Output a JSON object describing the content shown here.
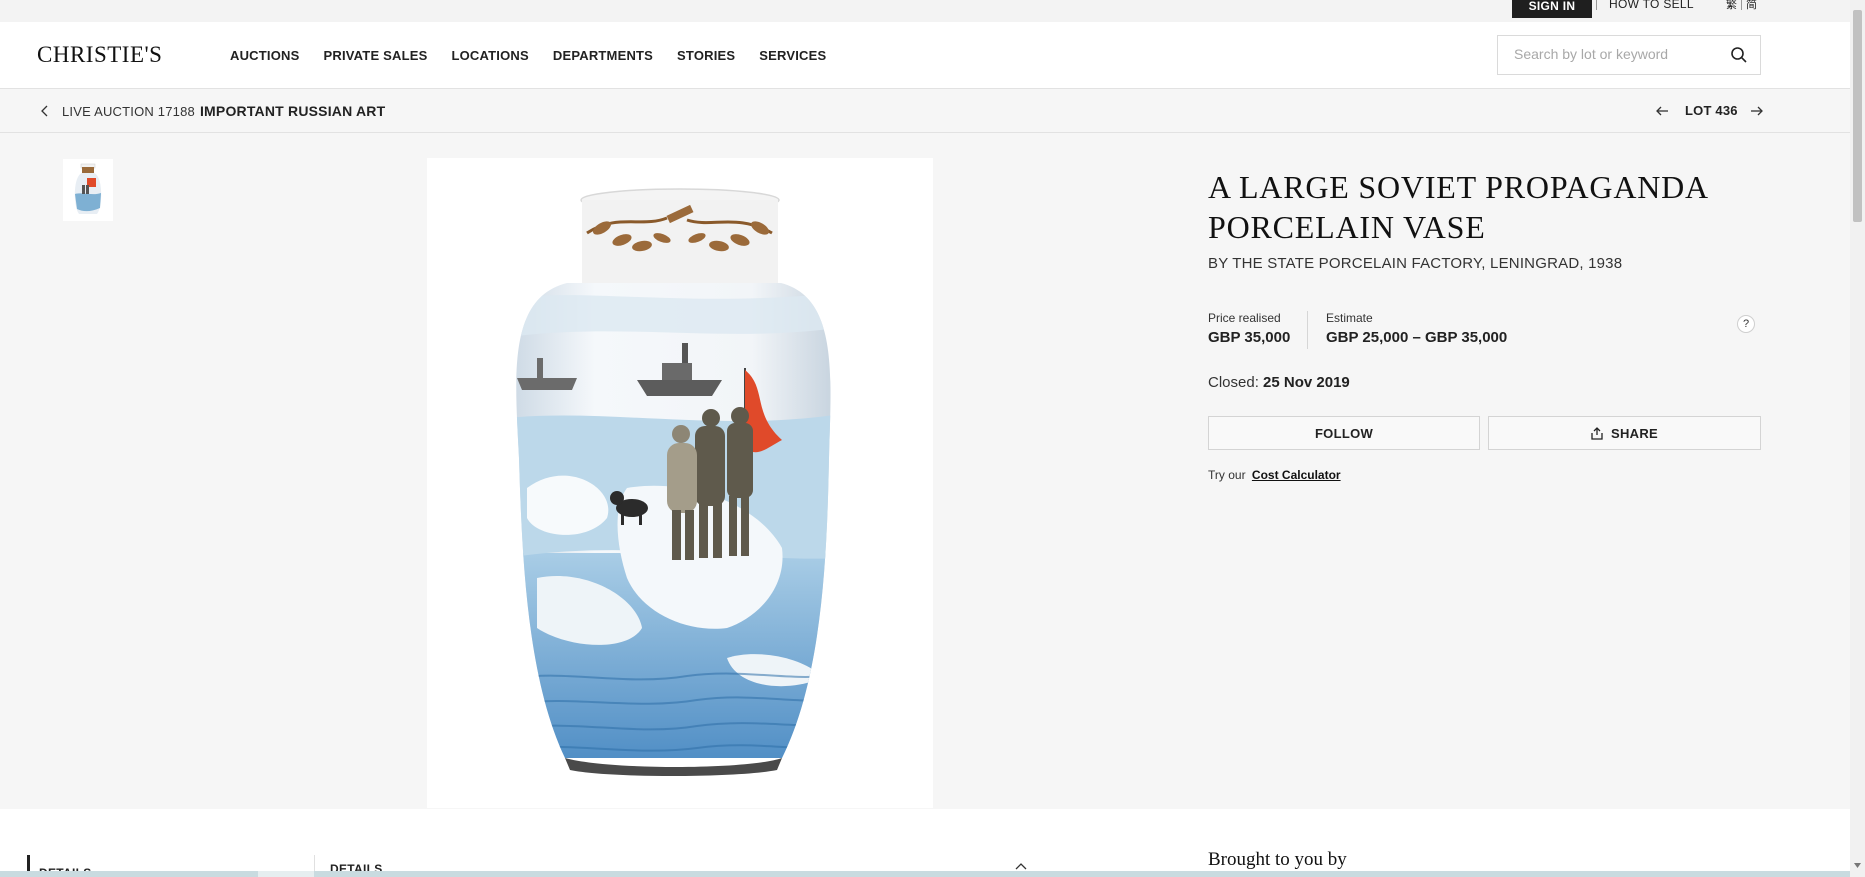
{
  "utility": {
    "sign_in": "SIGN IN",
    "how_to_sell": "HOW TO SELL",
    "lang_1": "繁",
    "lang_2": "简"
  },
  "header": {
    "logo": "CHRISTIE'S",
    "nav": [
      "AUCTIONS",
      "PRIVATE SALES",
      "LOCATIONS",
      "DEPARTMENTS",
      "STORIES",
      "SERVICES"
    ],
    "search_placeholder": "Search by lot or keyword"
  },
  "breadcrumb": {
    "label": "LIVE AUCTION 17188",
    "title": "IMPORTANT RUSSIAN ART",
    "lot": "LOT 436"
  },
  "lot": {
    "title": "A LARGE SOVIET PROPAGANDA PORCELAIN VASE",
    "subtitle": "BY THE STATE PORCELAIN FACTORY, LENINGRAD, 1938",
    "price_realised_label": "Price realised",
    "price_realised": "GBP 35,000",
    "estimate_label": "Estimate",
    "estimate": "GBP 25,000 – GBP 35,000",
    "help": "?",
    "closed_label": "Closed:",
    "closed_date": "25 Nov 2019",
    "follow": "FOLLOW",
    "share": "SHARE",
    "cost_prefix": "Try our",
    "cost_link": "Cost Calculator"
  },
  "lower": {
    "tab_label": "DETAILS",
    "section_head": "DETAILS",
    "brought": "Brought to you by"
  },
  "colors": {
    "accent_dark": "#1f1f1f",
    "flag_red": "#e04a2a",
    "page_bg": "#f6f6f6"
  }
}
